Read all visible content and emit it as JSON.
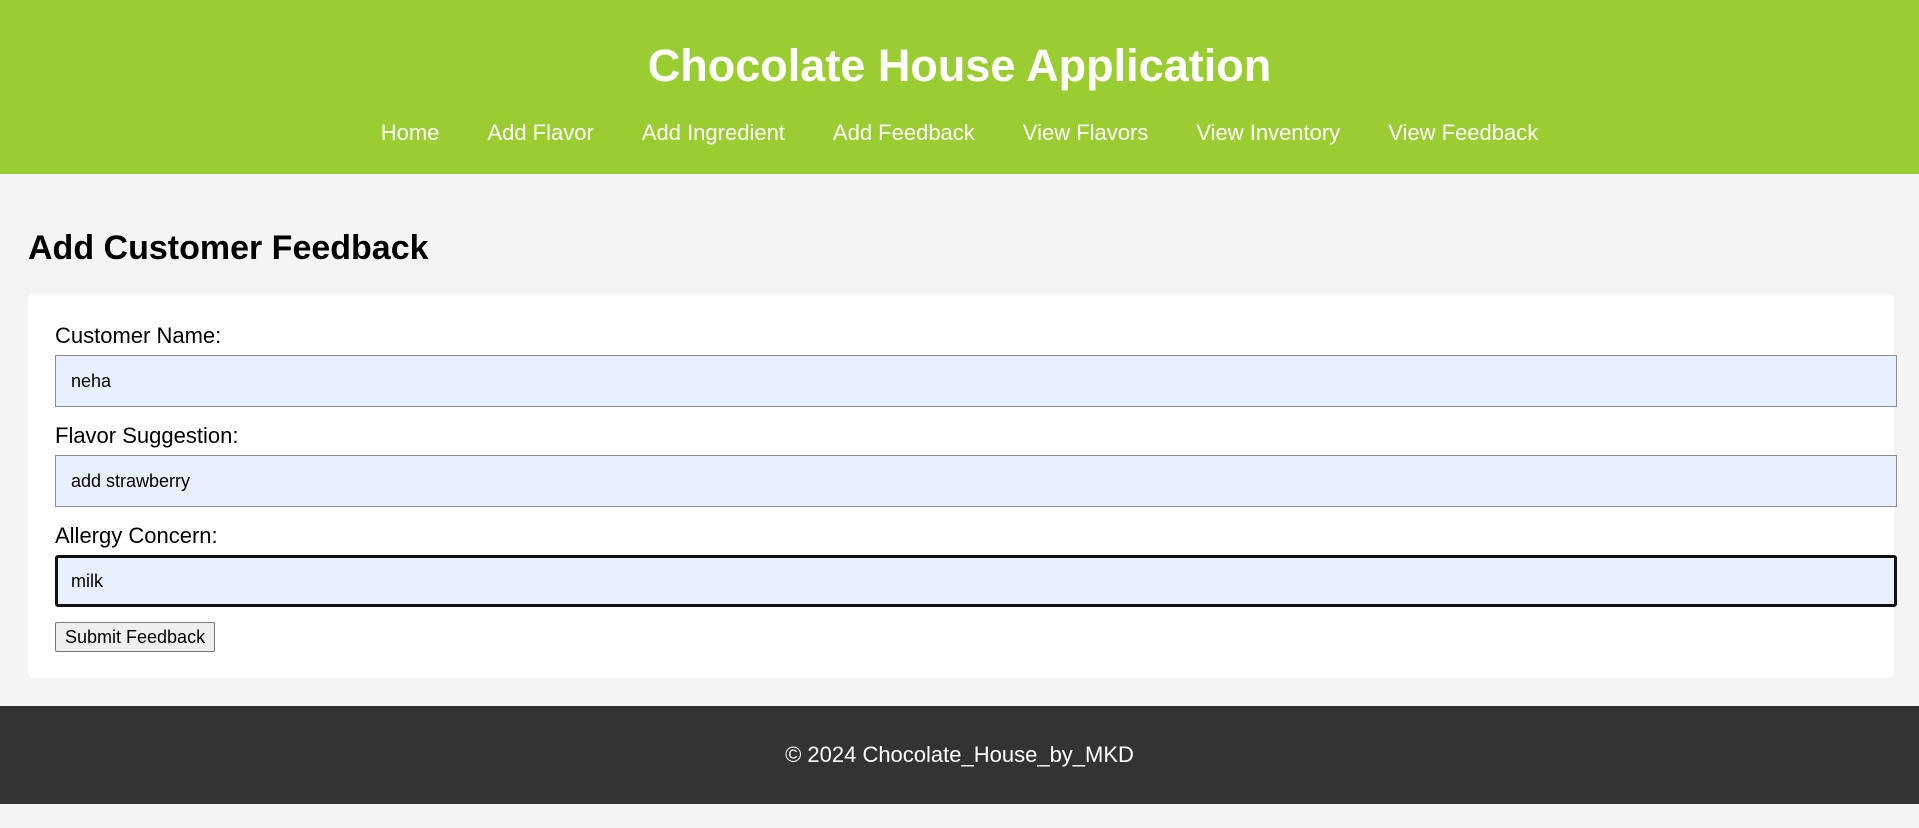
{
  "header": {
    "title": "Chocolate House Application",
    "nav": [
      {
        "label": "Home"
      },
      {
        "label": "Add Flavor"
      },
      {
        "label": "Add Ingredient"
      },
      {
        "label": "Add Feedback"
      },
      {
        "label": "View Flavors"
      },
      {
        "label": "View Inventory"
      },
      {
        "label": "View Feedback"
      }
    ]
  },
  "main": {
    "page_title": "Add Customer Feedback",
    "form": {
      "customer_name_label": "Customer Name:",
      "customer_name_value": "neha",
      "flavor_suggestion_label": "Flavor Suggestion:",
      "flavor_suggestion_value": "add strawberry",
      "allergy_concern_label": "Allergy Concern:",
      "allergy_concern_value": "milk",
      "submit_label": "Submit Feedback"
    }
  },
  "footer": {
    "text": "© 2024 Chocolate_House_by_MKD"
  },
  "colors": {
    "header_bg": "#9acd32",
    "page_bg": "#f4f4f4",
    "input_bg": "#e8f0fe",
    "footer_bg": "#333333"
  }
}
